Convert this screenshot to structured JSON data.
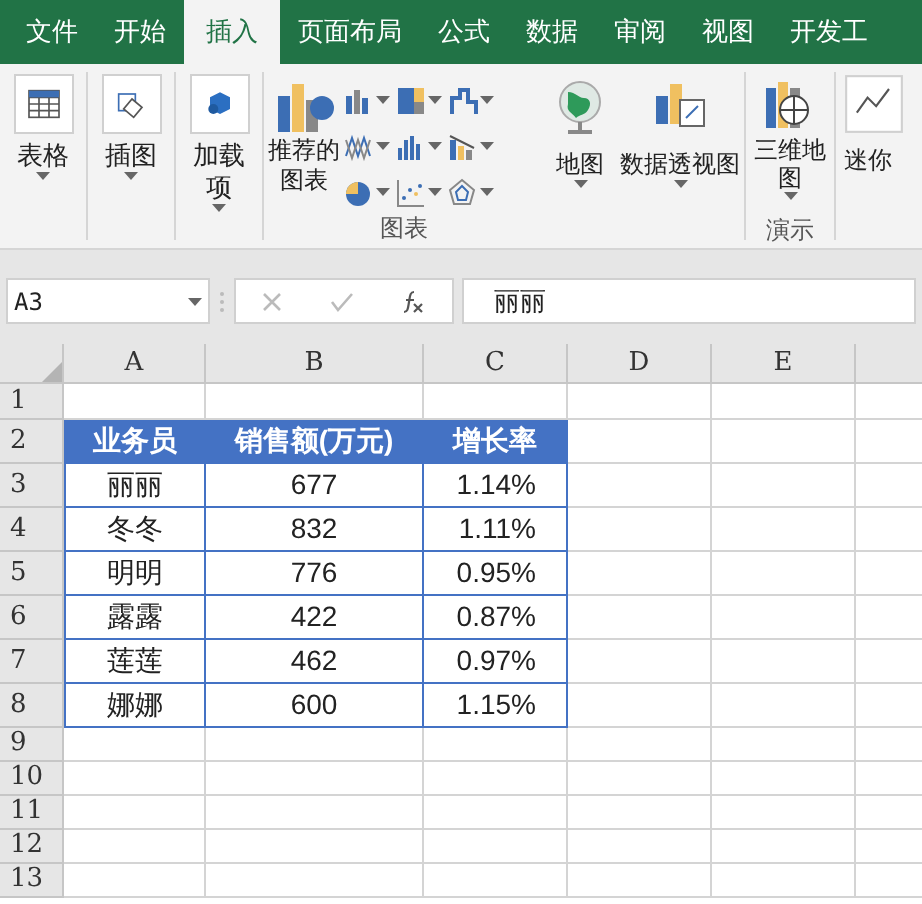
{
  "tabs": [
    {
      "label": "文件",
      "selected": false
    },
    {
      "label": "开始",
      "selected": false
    },
    {
      "label": "插入",
      "selected": true
    },
    {
      "label": "页面布局",
      "selected": false
    },
    {
      "label": "公式",
      "selected": false
    },
    {
      "label": "数据",
      "selected": false
    },
    {
      "label": "审阅",
      "selected": false
    },
    {
      "label": "视图",
      "selected": false
    },
    {
      "label": "开发工",
      "selected": false
    }
  ],
  "ribbon": {
    "buttons": [
      {
        "kind": "table",
        "label": "表格"
      },
      {
        "kind": "illustration",
        "label": "插图"
      },
      {
        "kind": "addin",
        "label": "加载项"
      }
    ],
    "chart_group": {
      "label": "图表",
      "recommended": "推荐的图表",
      "map": "地图",
      "pivot": "数据透视图"
    },
    "tour_group": {
      "label": "演示",
      "button": "三维地图"
    },
    "cut_button": "迷你"
  },
  "formula_bar": {
    "name_box": "A3",
    "content": "丽丽"
  },
  "sheet": {
    "columns": [
      "A",
      "B",
      "C",
      "D",
      "E"
    ],
    "rows": [
      {
        "number": "1",
        "cells": []
      },
      {
        "number": "2",
        "header": true,
        "cells": [
          "业务员",
          "销售额(万元)",
          "增长率"
        ]
      },
      {
        "number": "3",
        "cells": [
          "丽丽",
          "677",
          "1.14%"
        ]
      },
      {
        "number": "4",
        "cells": [
          "冬冬",
          "832",
          "1.11%"
        ]
      },
      {
        "number": "5",
        "cells": [
          "明明",
          "776",
          "0.95%"
        ]
      },
      {
        "number": "6",
        "cells": [
          "露露",
          "422",
          "0.87%"
        ]
      },
      {
        "number": "7",
        "cells": [
          "莲莲",
          "462",
          "0.97%"
        ]
      },
      {
        "number": "8",
        "cells": [
          "娜娜",
          "600",
          "1.15%"
        ]
      },
      {
        "number": "9",
        "cells": []
      },
      {
        "number": "10",
        "cells": []
      },
      {
        "number": "11",
        "cells": []
      },
      {
        "number": "12",
        "cells": []
      },
      {
        "number": "13",
        "cells": []
      }
    ]
  }
}
